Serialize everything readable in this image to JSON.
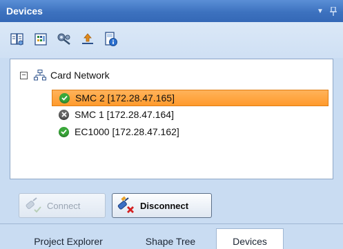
{
  "panel": {
    "title": "Devices"
  },
  "toolbar": {
    "icons": [
      "device-list-icon",
      "device-config-icon",
      "settings-wrench-icon",
      "upload-icon",
      "device-info-icon"
    ]
  },
  "tree": {
    "root_label": "Card Network",
    "devices": [
      {
        "label": "SMC 2 [172.28.47.165]",
        "status": "connected",
        "selected": true
      },
      {
        "label": "SMC 1 [172.28.47.164]",
        "status": "offline",
        "selected": false
      },
      {
        "label": "EC1000 [172.28.47.162]",
        "status": "connected",
        "selected": false
      }
    ]
  },
  "buttons": {
    "connect_label": "Connect",
    "disconnect_label": "Disconnect"
  },
  "tabs": [
    {
      "label": "Project Explorer",
      "active": false
    },
    {
      "label": "Shape Tree",
      "active": false
    },
    {
      "label": "Devices",
      "active": true
    }
  ],
  "colors": {
    "title_bar": "#3d72bf",
    "selection": "#ff9a2c",
    "status_ok": "#3aa83a",
    "status_off": "#666666"
  }
}
